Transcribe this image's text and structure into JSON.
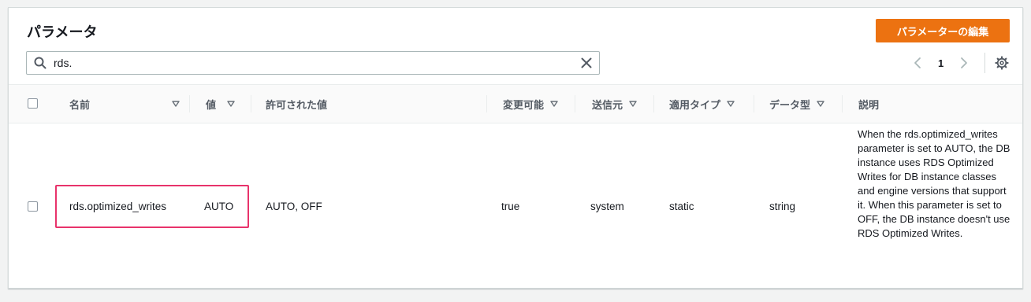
{
  "panel": {
    "title": "パラメータ",
    "edit_button": "パラメーターの編集"
  },
  "search": {
    "value": "rds.",
    "icon": "search-icon",
    "clear_icon": "close-icon"
  },
  "pagination": {
    "current_page": "1"
  },
  "table": {
    "headers": {
      "name": "名前",
      "value": "値",
      "allowed": "許可された値",
      "modifiable": "変更可能",
      "source": "送信元",
      "apply_type": "適用タイプ",
      "data_type": "データ型",
      "description": "説明"
    },
    "rows": [
      {
        "name": "rds.optimized_writes",
        "value": "AUTO",
        "allowed": "AUTO, OFF",
        "modifiable": "true",
        "source": "system",
        "apply_type": "static",
        "data_type": "string",
        "description": "When the rds.optimized_writes parameter is set to AUTO, the DB instance uses RDS Optimized Writes for DB instance classes and engine versions that support it. When this parameter is set to OFF, the DB instance doesn't use RDS Optimized Writes."
      }
    ]
  },
  "colors": {
    "primary_button": "#ec7211",
    "highlight_border": "#e8336b"
  }
}
